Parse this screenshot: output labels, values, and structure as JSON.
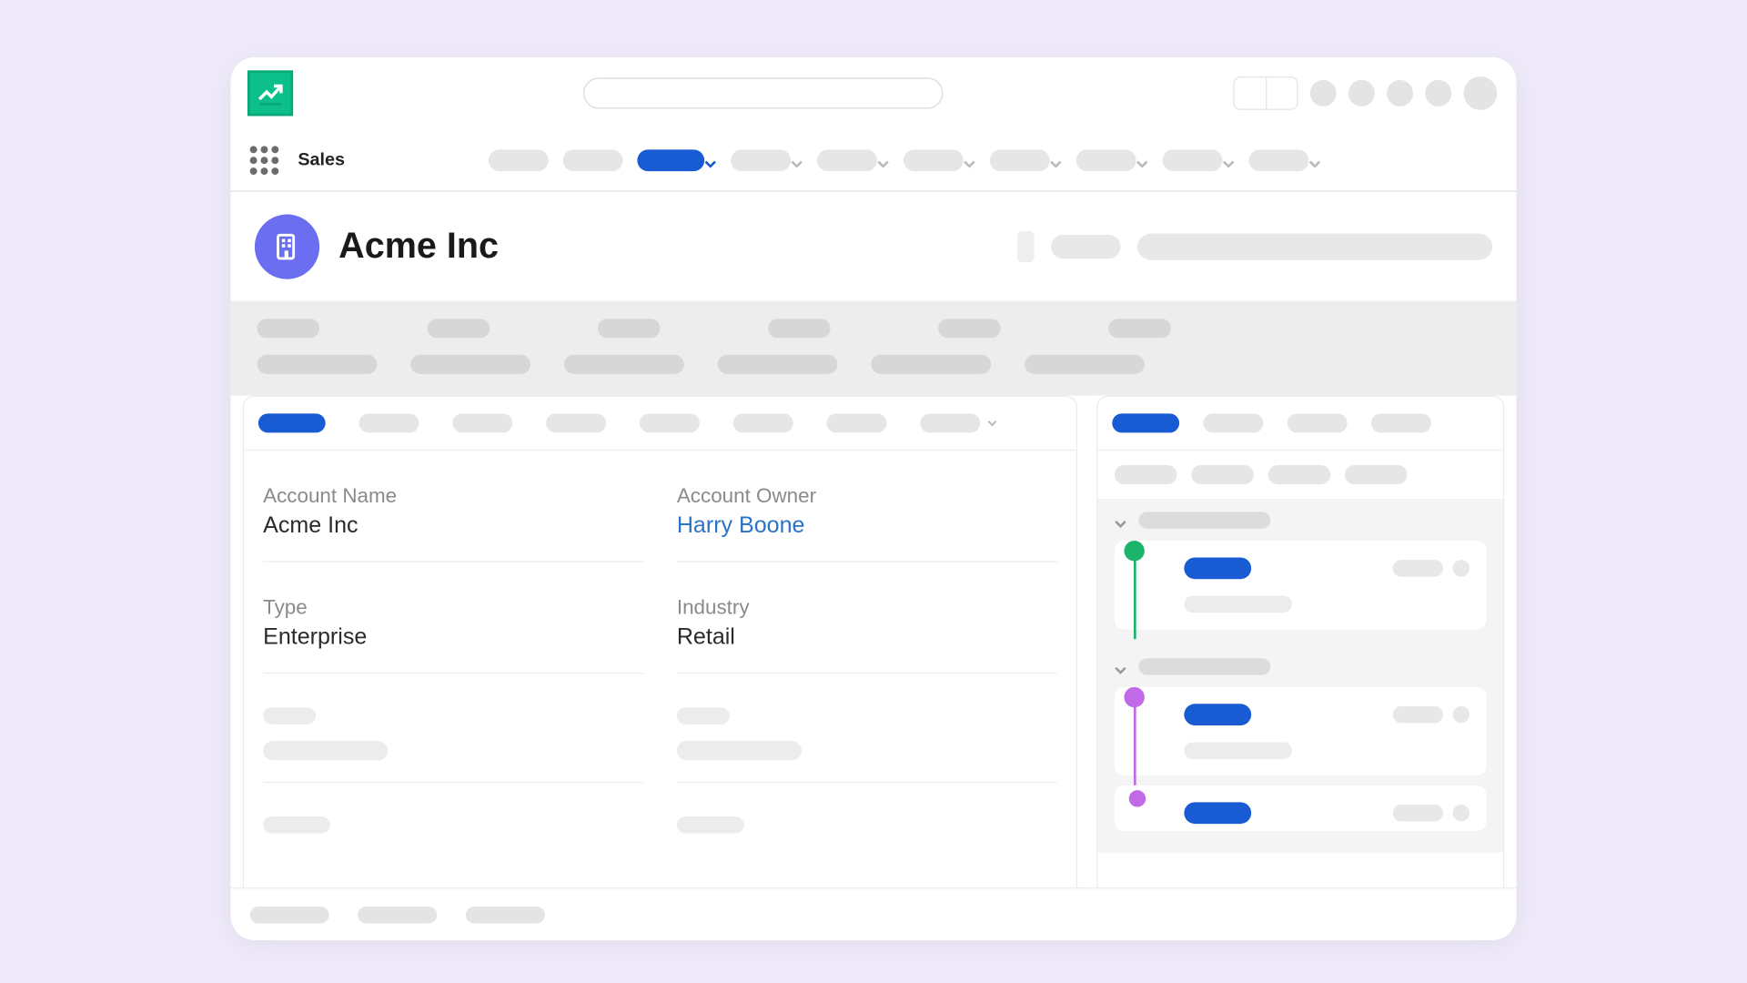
{
  "app": {
    "name": "Sales"
  },
  "record": {
    "title": "Acme Inc",
    "icon": "building-icon"
  },
  "details": {
    "account_name": {
      "label": "Account Name",
      "value": "Acme Inc"
    },
    "account_owner": {
      "label": "Account Owner",
      "value": "Harry Boone"
    },
    "type": {
      "label": "Type",
      "value": "Enterprise"
    },
    "industry": {
      "label": "Industry",
      "value": "Retail"
    }
  },
  "colors": {
    "brand_blue": "#185bd3",
    "link_blue": "#2a73c7",
    "logo_green": "#0dbf8a",
    "record_icon": "#6b6ef0",
    "timeline_green": "#1cb46b",
    "timeline_purple": "#c06ae8"
  }
}
